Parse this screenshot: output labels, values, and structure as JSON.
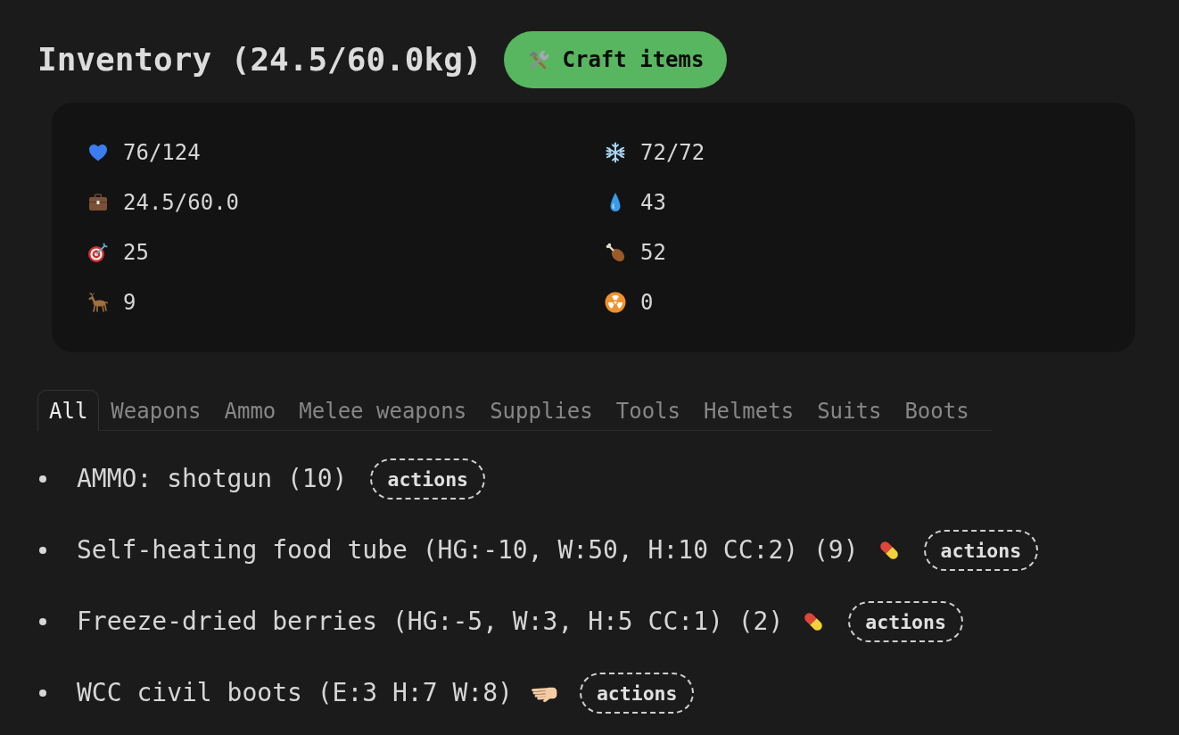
{
  "header": {
    "title": "Inventory (24.5/60.0kg)",
    "craft_button": "Craft items"
  },
  "stats": [
    {
      "value": "76/124"
    },
    {
      "value": "72/72"
    },
    {
      "value": "24.5/60.0"
    },
    {
      "value": "43"
    },
    {
      "value": "25"
    },
    {
      "value": "52"
    },
    {
      "value": "9"
    },
    {
      "value": "0"
    }
  ],
  "tabs": [
    {
      "label": "All",
      "selected": true
    },
    {
      "label": "Weapons",
      "selected": false
    },
    {
      "label": "Ammo",
      "selected": false
    },
    {
      "label": "Melee weapons",
      "selected": false
    },
    {
      "label": "Supplies",
      "selected": false
    },
    {
      "label": "Tools",
      "selected": false
    },
    {
      "label": "Helmets",
      "selected": false
    },
    {
      "label": "Suits",
      "selected": false
    },
    {
      "label": "Boots",
      "selected": false
    }
  ],
  "items": [
    {
      "kind": "ammo",
      "label": "AMMO: shotgun (10)",
      "action": "actions"
    },
    {
      "kind": "consumable",
      "label": "Self-heating food tube (HG:-10, W:50, H:10 CC:2) (9)",
      "action": "actions"
    },
    {
      "kind": "consumable",
      "label": "Freeze-dried berries (HG:-5, W:3, H:5 CC:1) (2)",
      "action": "actions"
    },
    {
      "kind": "wearable",
      "label": "WCC civil boots (E:3 H:7 W:8)",
      "action": "actions"
    }
  ]
}
